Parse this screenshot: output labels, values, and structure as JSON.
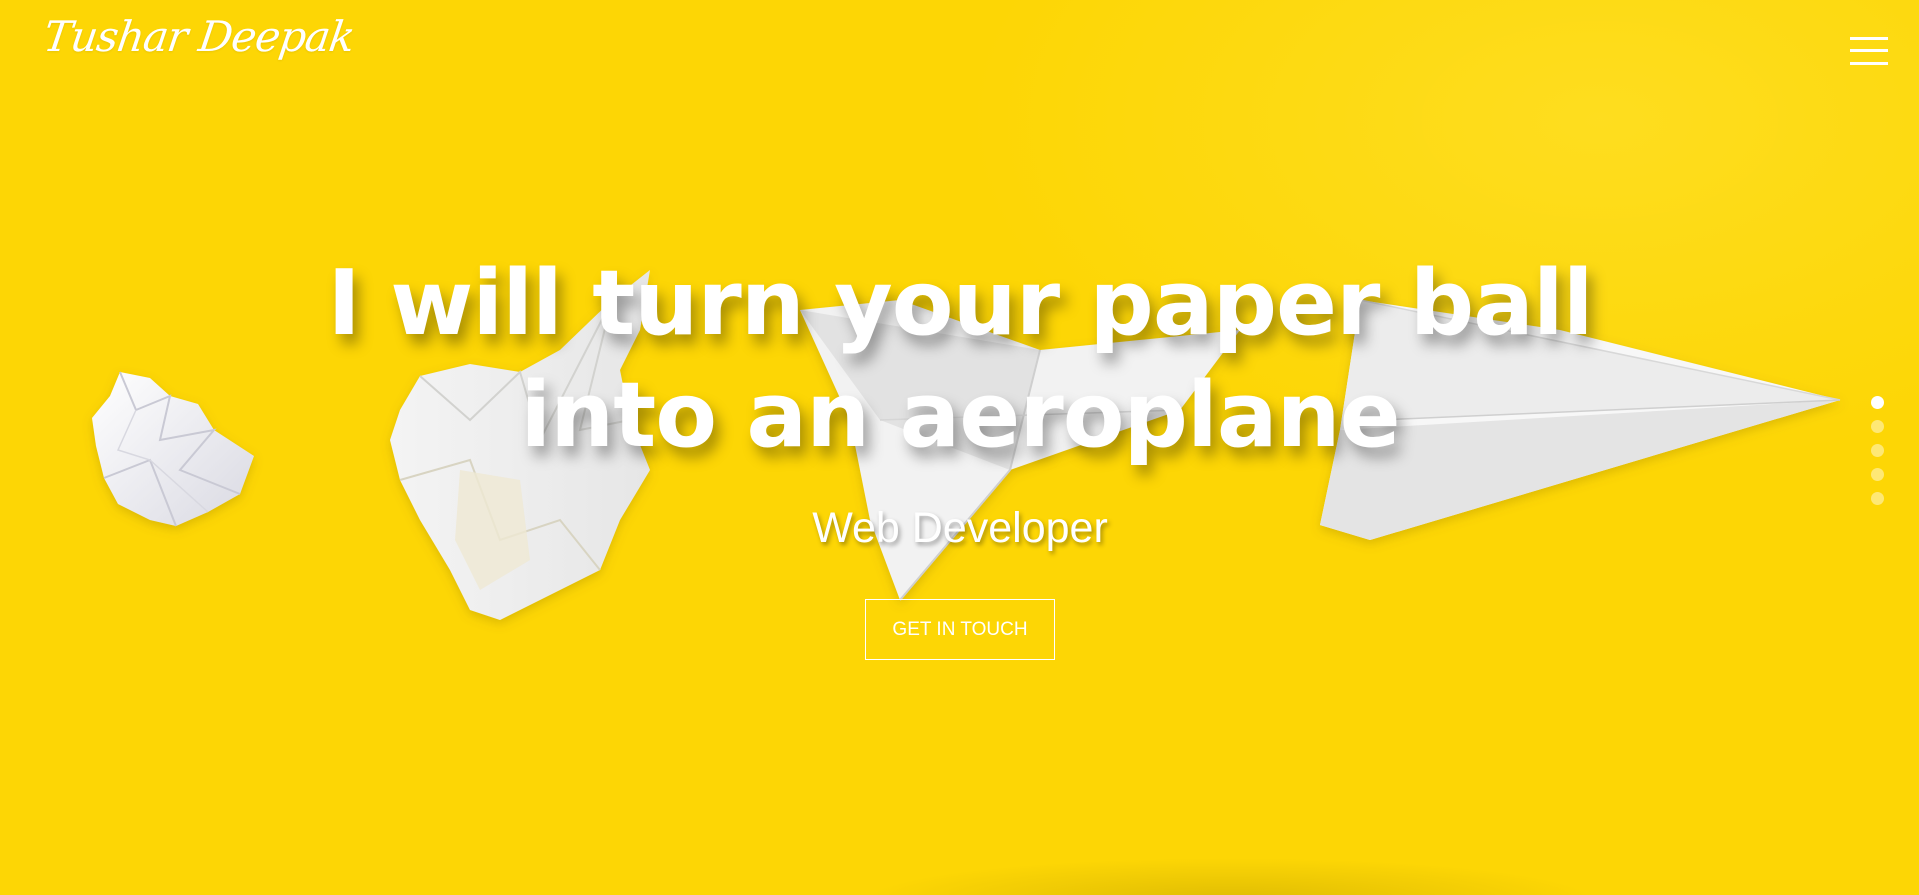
{
  "brand": {
    "logo_text": "Tushar Deepak"
  },
  "header": {
    "menu_icon": "hamburger-icon"
  },
  "hero": {
    "title_line1": "I will turn your paper ball",
    "title_line2": "into an aeroplane",
    "subtitle": "Web Developer",
    "cta_label": "GET IN TOUCH"
  },
  "slider": {
    "total": 5,
    "active_index": 0
  },
  "colors": {
    "background": "#FDD605",
    "text": "#FFFFFF"
  }
}
